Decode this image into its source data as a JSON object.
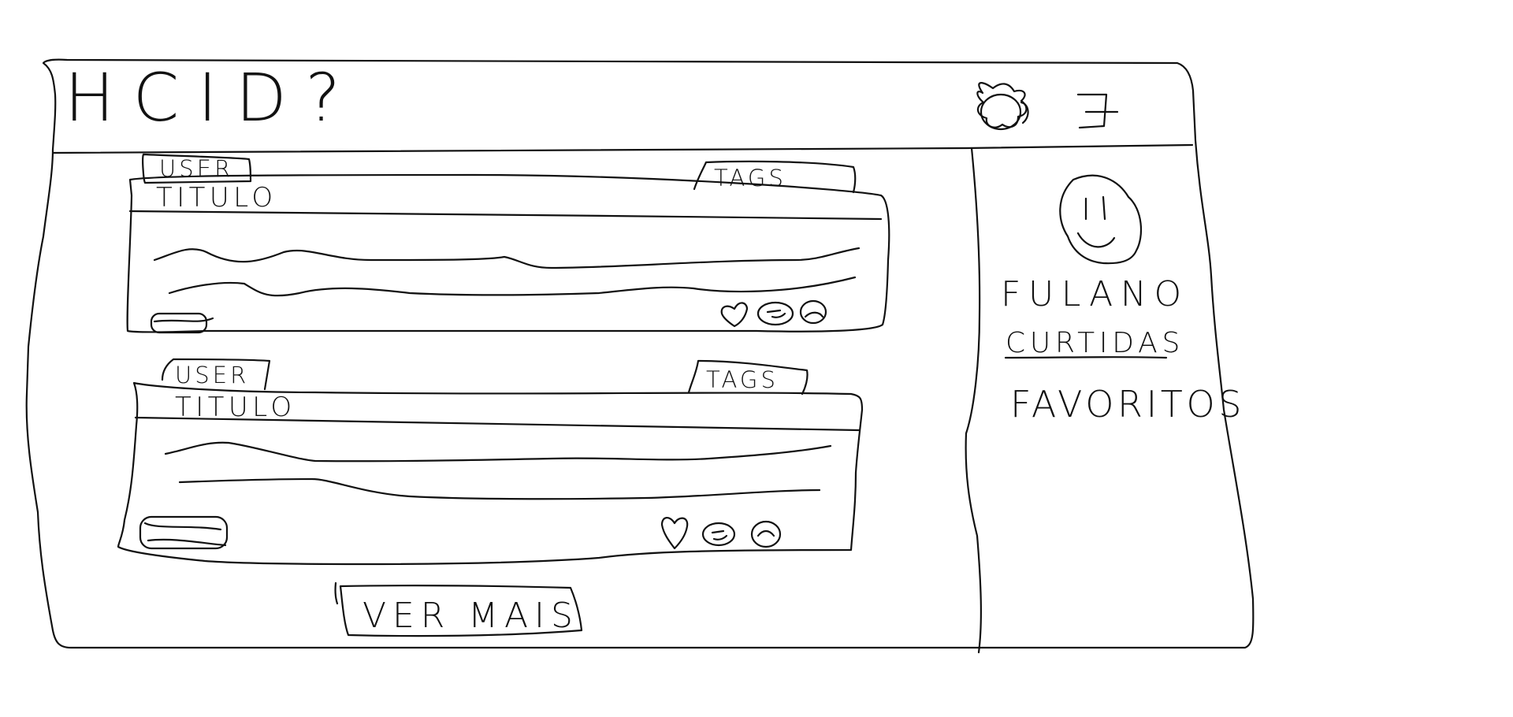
{
  "header": {
    "logo_text": "HCID?",
    "settings_icon": "gear-icon",
    "menu_icon": "menu-icon"
  },
  "posts": [
    {
      "user_tab": "USER",
      "tags_tab": "TAGS",
      "title": "TITULO",
      "actions": [
        "heart-icon",
        "happy-face-icon",
        "sad-face-icon"
      ]
    },
    {
      "user_tab": "USER",
      "tags_tab": "TAGS",
      "title": "TITULO",
      "actions": [
        "heart-icon",
        "happy-face-icon",
        "sad-face-icon"
      ]
    }
  ],
  "load_more_label": "VER MAIS",
  "sidebar": {
    "avatar_icon": "smiley-avatar-icon",
    "user_name": "FULANO",
    "links": [
      "CURTIDAS",
      "FAVORITOS"
    ]
  }
}
